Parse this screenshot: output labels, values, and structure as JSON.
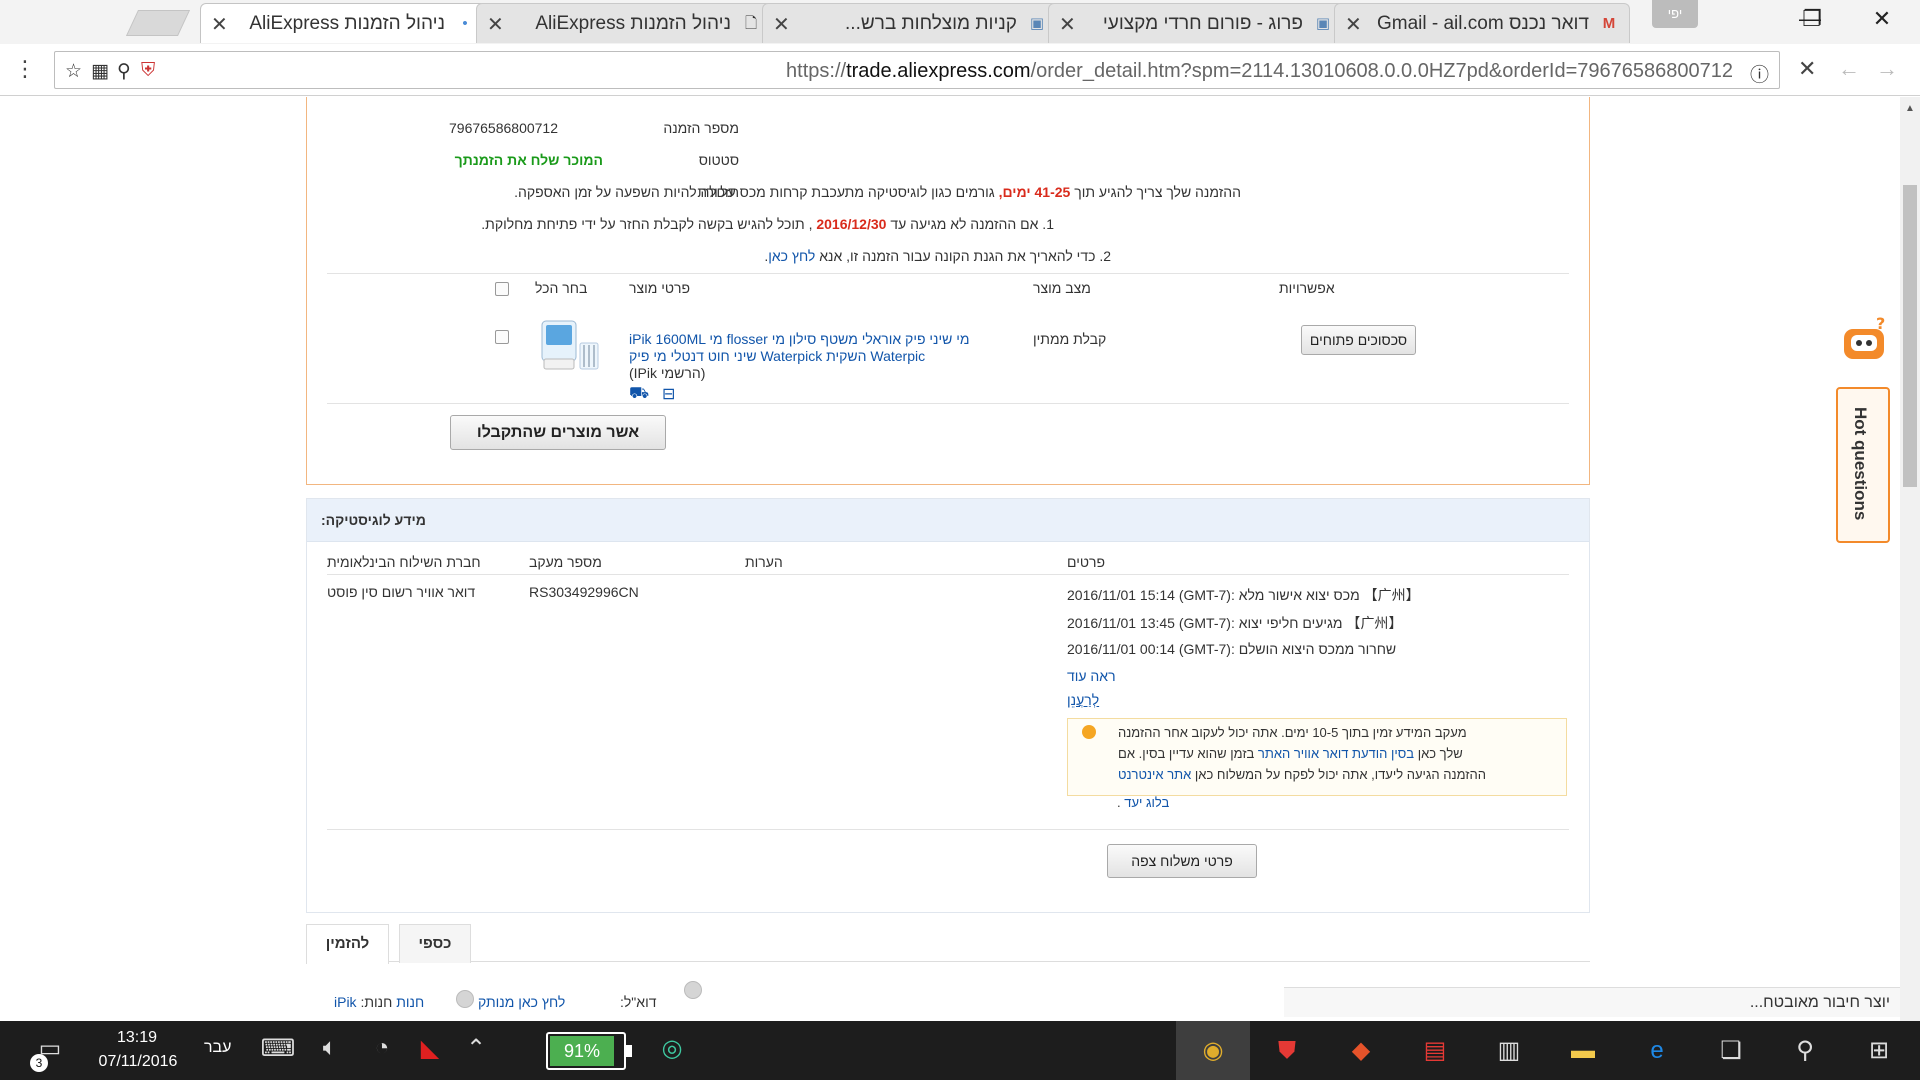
{
  "browser": {
    "tabs": [
      {
        "title": "ניהול הזמנות AliExpress",
        "icon": "globe-icon",
        "active": true
      },
      {
        "title": "ניהול הזמנות AliExpress",
        "icon": "document-icon",
        "active": false
      },
      {
        "title": "קניות מוצלחות ברש...",
        "icon": "forum-icon",
        "active": false
      },
      {
        "title": "פרוג - פורום חרדי מקצועי",
        "icon": "forum-icon",
        "active": false
      },
      {
        "title": "דואר נכנס Gmail - ail.com",
        "icon": "gmail-icon",
        "active": false
      }
    ],
    "profile_label": "יפי",
    "url_prefix": "https://",
    "url_host": "trade.aliexpress.com",
    "url_path": "/order_detail.htm?spm=2114.13010608.0.0.0HZ7pd&orderId=79676586800712"
  },
  "order": {
    "number_label": "מספר הזמנה",
    "number_value": "79676586800712",
    "status_label": "סטטוס",
    "status_value": "המוכר שלח את הזמנתך",
    "reminder_label": "תזכורת",
    "reminder_1_pre": "ההזמנה שלך צריך להגיע תוך",
    "reminder_1_days": "41-25 ימים,",
    "reminder_1_post": "גורמים כגון לוגיסטיקה מתעכבת קרחות מכס עלולה להיות השפעה על זמן האספקה.",
    "reminder_2_pre": "1. אם ההזמנה לא מגיעה עד",
    "reminder_2_date": "2016/12/30",
    "reminder_2_post": ", תוכל להגיש בקשה לקבלת החזר על ידי פתיחת מחלוקת.",
    "reminder_3_pre": "2. כדי להאריך את הגנת הקונה עבור הזמנה זו, אנא",
    "reminder_3_link": "לחץ כאן",
    "reminder_3_post": "."
  },
  "products": {
    "headers": {
      "select_all": "בחר הכל",
      "details": "פרטי מוצר",
      "state": "מצב מוצר",
      "options": "אפשרויות"
    },
    "items": [
      {
        "title_line1": "iPik 1600ML מי flosser מי שיני פיק אוראלי משטף סילון מי",
        "title_line2": "שיני חוט דנטלי מי פיק Waterpick השקית Waterpic",
        "title_line3": "(IPik הרשמי)",
        "state": "קבלת ממתין",
        "action": "סכסוכים פתוחים"
      }
    ],
    "confirm_button": "אשר מוצרים שהתקבלו"
  },
  "logistics": {
    "title": "מידע לוגיסטיקה:",
    "headers": {
      "company": "חברת השילוח הבינלאומית",
      "tracking": "מספר מעקב",
      "notes": "הערות",
      "details": "פרטים"
    },
    "company": "דואר אוויר רשום סין פוסט",
    "tracking_number": "RS303492996CN",
    "events": [
      {
        "time": "2016/11/01 15:14 (GMT-7):",
        "text": "【广州】 מכס יצוא אישור מלא"
      },
      {
        "time": "2016/11/01 13:45 (GMT-7):",
        "text": "【广州】 מגיעים חליפי יצוא"
      },
      {
        "time": "2016/11/01 00:14 (GMT-7):",
        "text": "שחרור ממכס היצוא הושלם"
      }
    ],
    "see_more": "ראה עוד",
    "refresh": "לְרַעֲנֵן",
    "note_line1": "מעקב המידע זמין בתוך 10-5 ימים. אתה יכול לעקוב אחר ההזמנה",
    "note_line2_pre": "שלך כאן",
    "note_line2_link": "בסין הודעת דואר אוויר האתר",
    "note_line2_post": "בזמן שהוא עדיין בסין. אם",
    "note_line3_pre": "ההזמנה הגיעה ליעדו, אתה יכול לפקח על המשלוח כאן",
    "note_line3_link": "אתר אינטרנט",
    "note_line4_link": "בלוג יעד",
    "note_line4_post": ".",
    "shipping_details_button": "פרטי משלוח צפה"
  },
  "page_tabs": [
    {
      "label": "להזמין",
      "active": true
    },
    {
      "label": "כספי",
      "active": false
    }
  ],
  "store": {
    "label": "חנות:",
    "name": "iPik",
    "store_link": "חנות",
    "contact_link": "לחץ כאן מנותק",
    "email_label": "דוא\"ל:"
  },
  "hot_questions": "Hot questions",
  "download_bar": "יוצר חיבור מאובטח...",
  "taskbar": {
    "time": "13:19",
    "date": "07/11/2016",
    "language": "עבר",
    "battery": "91%",
    "notifications": "3"
  },
  "colors": {
    "accent": "#f38a2a",
    "link": "#1155aa",
    "red": "#d92b1c",
    "green": "#1a9a1a"
  }
}
